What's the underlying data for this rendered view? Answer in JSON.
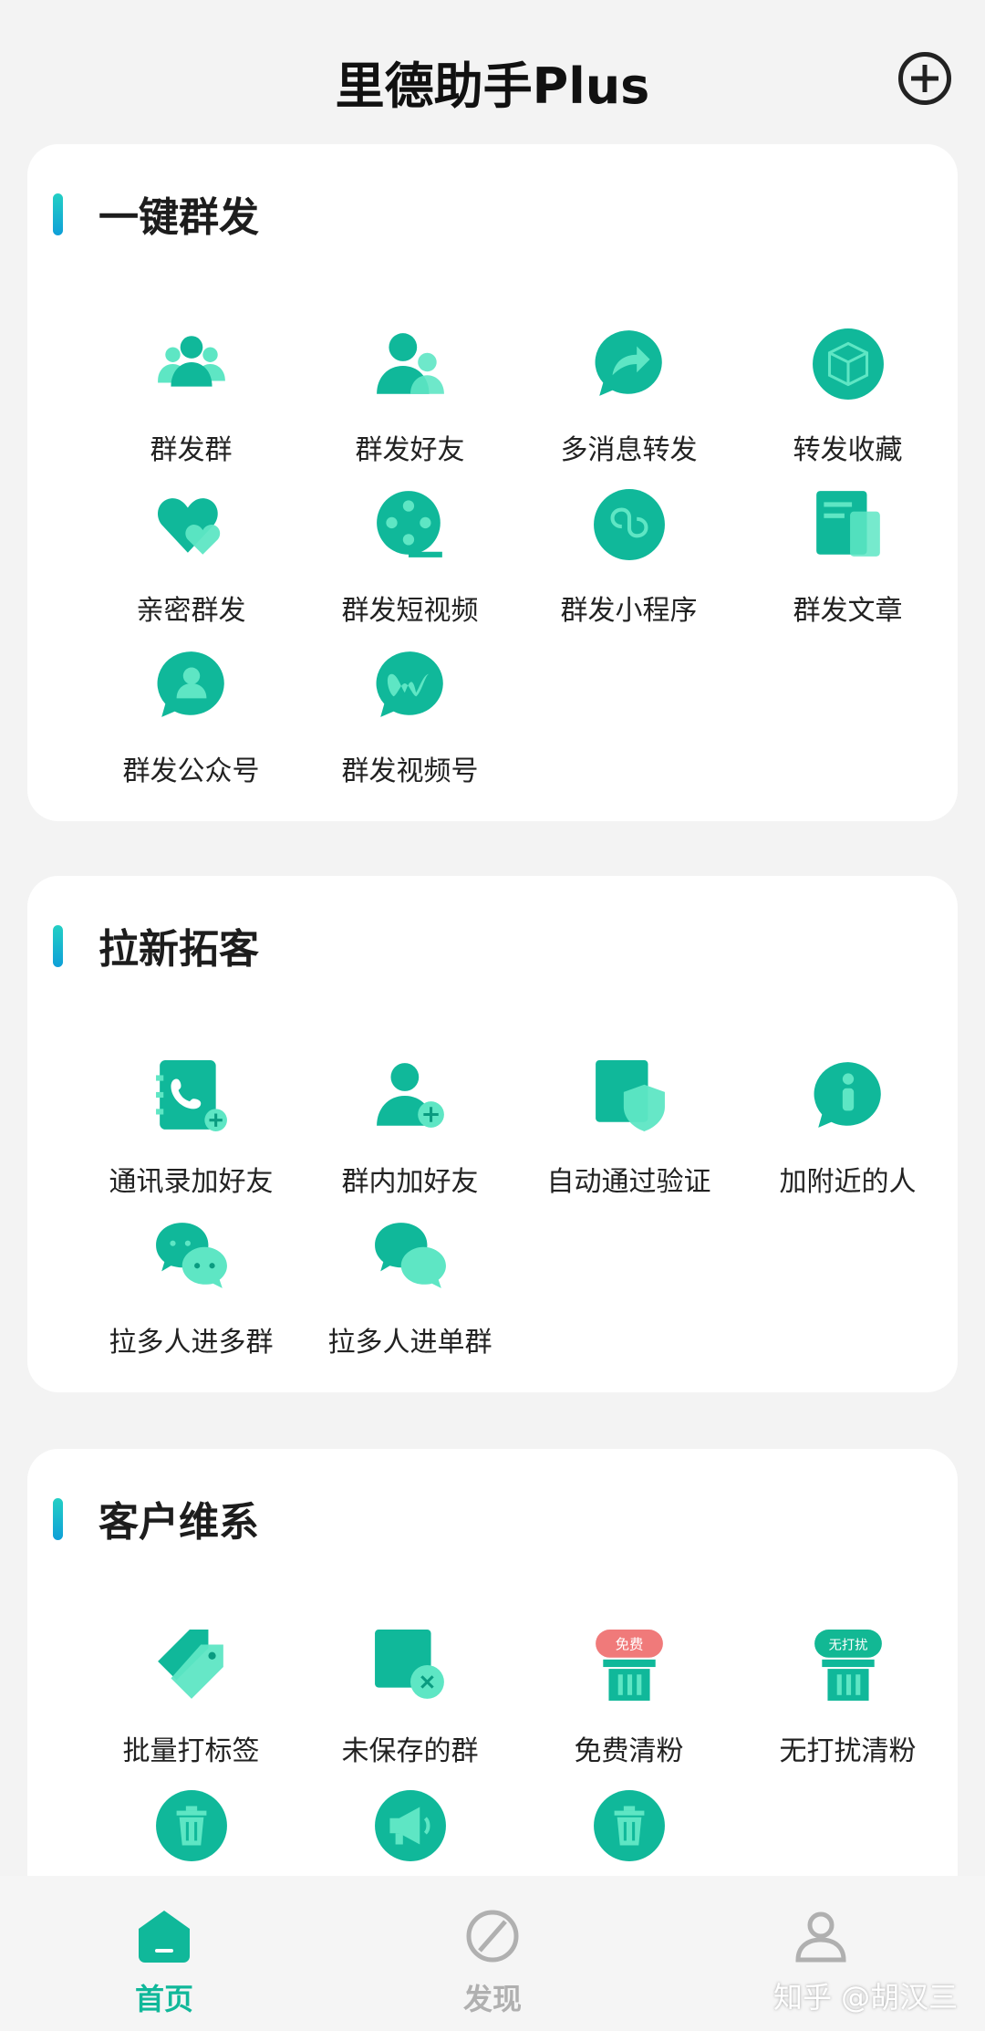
{
  "header": {
    "title": "里德助手Plus"
  },
  "colors": {
    "accent": "#10b89a",
    "accent_light": "#5ee6c4",
    "accent_dark": "#0a9b80"
  },
  "sections": [
    {
      "title": "一键群发",
      "items": [
        {
          "label": "群发群",
          "icon": "group-icon"
        },
        {
          "label": "群发好友",
          "icon": "friends-icon"
        },
        {
          "label": "多消息转发",
          "icon": "forward-icon"
        },
        {
          "label": "转发收藏",
          "icon": "cube-icon"
        },
        {
          "label": "亲密群发",
          "icon": "hearts-icon"
        },
        {
          "label": "群发短视频",
          "icon": "film-reel-icon"
        },
        {
          "label": "群发小程序",
          "icon": "mini-program-icon"
        },
        {
          "label": "群发文章",
          "icon": "article-icon"
        },
        {
          "label": "群发公众号",
          "icon": "official-account-icon"
        },
        {
          "label": "群发视频号",
          "icon": "channels-icon"
        }
      ]
    },
    {
      "title": "拉新拓客",
      "items": [
        {
          "label": "通讯录加好友",
          "icon": "contacts-add-icon"
        },
        {
          "label": "群内加好友",
          "icon": "person-add-icon"
        },
        {
          "label": "自动通过验证",
          "icon": "shield-icon"
        },
        {
          "label": "加附近的人",
          "icon": "nearby-info-icon"
        },
        {
          "label": "拉多人进多群",
          "icon": "chat-bubbles-icon"
        },
        {
          "label": "拉多人进单群",
          "icon": "chat-bubbles-2-icon"
        }
      ]
    },
    {
      "title": "客户维系",
      "items": [
        {
          "label": "批量打标签",
          "icon": "tag-icon"
        },
        {
          "label": "未保存的群",
          "icon": "unsaved-group-icon"
        },
        {
          "label": "免费清粉",
          "icon": "trash-badge-icon",
          "badge": "免费",
          "badge_color": "#f07a7a"
        },
        {
          "label": "无打扰清粉",
          "icon": "trash-badge-icon",
          "badge": "无打扰",
          "badge_color": "#12b894"
        },
        {
          "label": "",
          "icon": "trash-circle-icon"
        },
        {
          "label": "",
          "icon": "megaphone-icon"
        },
        {
          "label": "",
          "icon": "trash-circle-icon"
        }
      ]
    }
  ],
  "tabbar": {
    "items": [
      {
        "label": "首页",
        "icon": "home-icon",
        "active": true
      },
      {
        "label": "发现",
        "icon": "compass-icon",
        "active": false
      },
      {
        "label": "",
        "icon": "profile-icon",
        "active": false
      }
    ]
  },
  "watermark": "知乎 @胡汉三"
}
